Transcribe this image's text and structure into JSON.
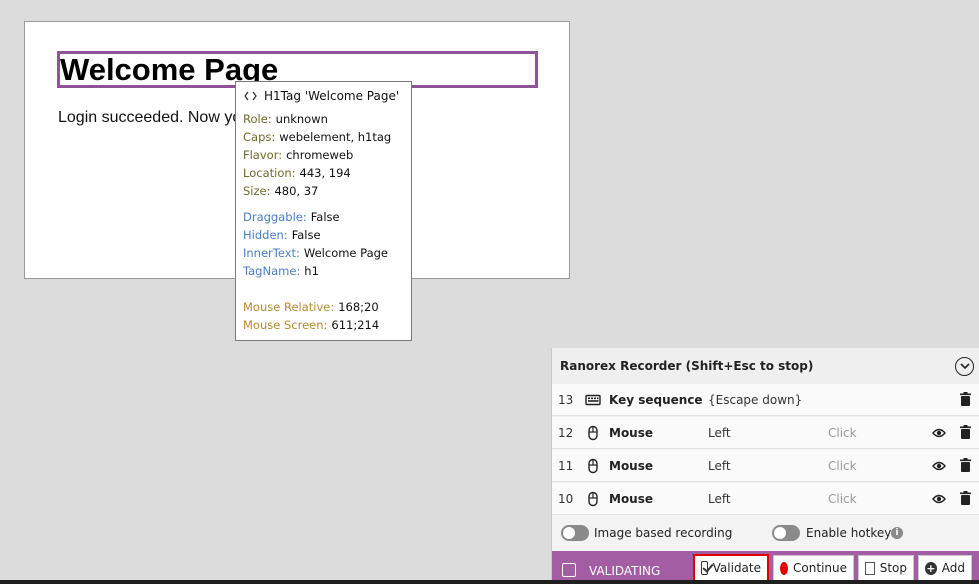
{
  "web_page": {
    "heading": "Welcome Page",
    "body_text": "Login succeeded. Now yo"
  },
  "tooltip": {
    "title": "H1Tag 'Welcome Page'",
    "icon": "code-icon",
    "basic": [
      {
        "key": "Role:",
        "value": "unknown"
      },
      {
        "key": "Caps:",
        "value": "webelement, h1tag"
      },
      {
        "key": "Flavor:",
        "value": "chromeweb"
      },
      {
        "key": "Location:",
        "value": "443, 194"
      },
      {
        "key": "Size:",
        "value": "480, 37"
      }
    ],
    "attributes": [
      {
        "key": "Draggable:",
        "value": "False"
      },
      {
        "key": "Hidden:",
        "value": "False"
      },
      {
        "key": "InnerText:",
        "value": "Welcome Page"
      },
      {
        "key": "TagName:",
        "value": "h1"
      }
    ],
    "mouse": [
      {
        "key": "Mouse Relative:",
        "value": "168;20"
      },
      {
        "key": "Mouse Screen:",
        "value": "611;214"
      }
    ]
  },
  "recorder": {
    "title": "Ranorex Recorder (Shift+Esc to stop)",
    "rows": [
      {
        "num": "13",
        "type": "Key sequence",
        "icon": "keyboard-icon",
        "detail": "{Escape down}",
        "action": ""
      },
      {
        "num": "12",
        "type": "Mouse",
        "icon": "mouse-icon",
        "detail": "Left",
        "action": "Click"
      },
      {
        "num": "11",
        "type": "Mouse",
        "icon": "mouse-icon",
        "detail": "Left",
        "action": "Click"
      },
      {
        "num": "10",
        "type": "Mouse",
        "icon": "mouse-icon",
        "detail": "Left",
        "action": "Click"
      }
    ],
    "toggles": {
      "image_based": "Image based recording",
      "hotkeys": "Enable hotkeys"
    },
    "status": "VALIDATING",
    "buttons": {
      "validate": "Validate",
      "continue": "Continue",
      "stop": "Stop",
      "add": "Add"
    },
    "colors": {
      "status_bar": "#a35ea3",
      "highlight": "#8e5497",
      "validate_border": "#e00000"
    }
  }
}
